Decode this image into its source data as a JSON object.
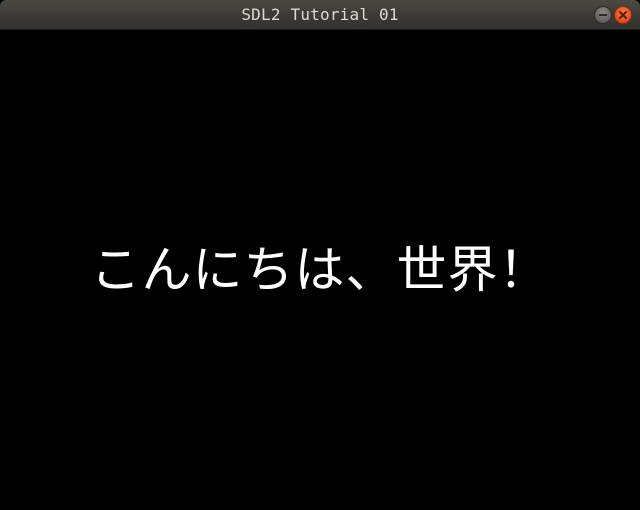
{
  "window": {
    "title": "SDL2 Tutorial 01",
    "controls": {
      "minimize_icon": "minimize-icon",
      "close_icon": "close-icon"
    },
    "colors": {
      "titlebar": "#3d3c38",
      "title_text": "#dfdbd2",
      "close_button": "#e6521f",
      "minimize_button": "#65635f",
      "canvas_background": "#000000",
      "text": "#ffffff"
    }
  },
  "canvas": {
    "message": "こんにちは、世界！"
  }
}
